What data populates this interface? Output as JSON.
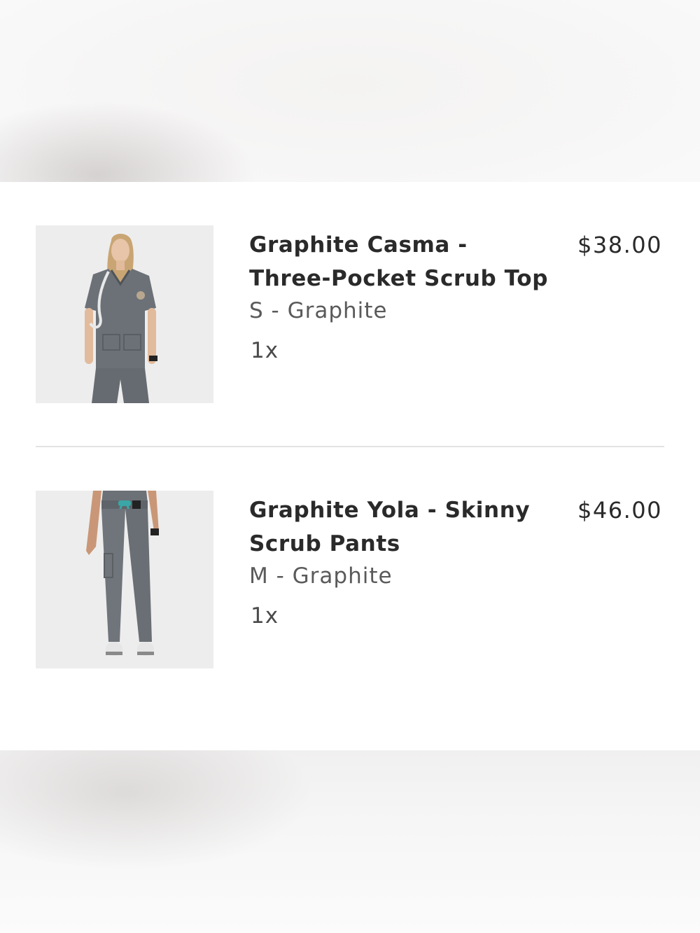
{
  "cart": {
    "items": [
      {
        "title": "Graphite Casma - Three-Pocket Scrub Top",
        "variant": "S - Graphite",
        "quantity": "1x",
        "price": "$38.00",
        "image_icon": "scrub-top-photo"
      },
      {
        "title": "Graphite Yola - Skinny Scrub Pants",
        "variant": "M - Graphite",
        "quantity": "1x",
        "price": "$46.00",
        "image_icon": "scrub-pants-photo"
      }
    ]
  }
}
